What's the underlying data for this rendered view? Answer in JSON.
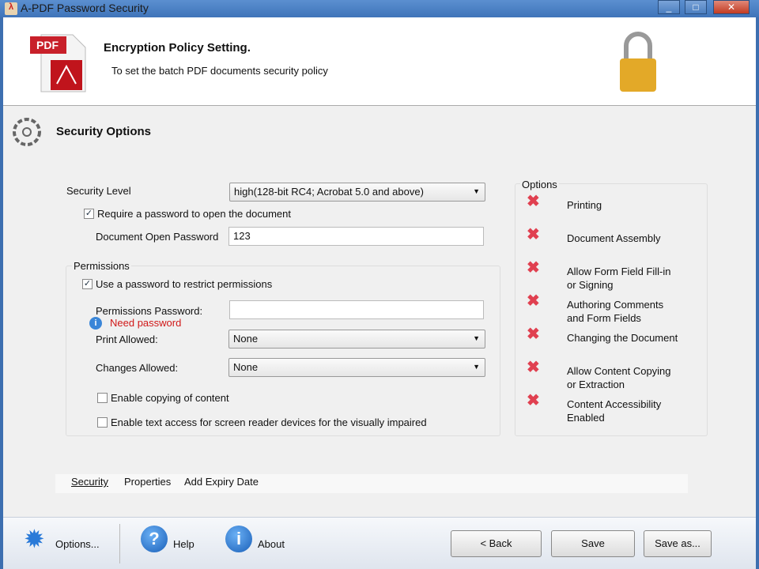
{
  "window": {
    "title": "A-PDF Password Security"
  },
  "header": {
    "title": "Encryption Policy Setting.",
    "subtitle": "To set the batch PDF documents security policy",
    "pdf_label": "PDF"
  },
  "section": {
    "title": "Security Options"
  },
  "form": {
    "security_level_label": "Security Level",
    "security_level_value": "high(128-bit RC4; Acrobat 5.0 and above)",
    "require_open_pw_label": "Require a password to open the document",
    "require_open_pw_checked": true,
    "open_pw_label": "Document Open Password",
    "open_pw_value": "123",
    "permissions_group": "Permissions",
    "use_perm_pw_label": "Use a password to restrict permissions",
    "use_perm_pw_checked": true,
    "perm_pw_label": "Permissions Password:",
    "perm_pw_value": "",
    "perm_pw_error": "Need password",
    "print_label": "Print Allowed:",
    "print_value": "None",
    "changes_label": "Changes Allowed:",
    "changes_value": "None",
    "enable_copy_label": "Enable copying of content",
    "enable_reader_label": "Enable text access for screen reader devices for the visually impaired"
  },
  "options": {
    "title": "Options",
    "items": [
      {
        "l1": "Printing",
        "l2": ""
      },
      {
        "l1": "Document Assembly",
        "l2": ""
      },
      {
        "l1": "Allow Form Field Fill-in",
        "l2": "or Signing"
      },
      {
        "l1": "Authoring Comments",
        "l2": "and Form Fields"
      },
      {
        "l1": "Changing the Document",
        "l2": ""
      },
      {
        "l1": "Allow Content Copying",
        "l2": "or Extraction"
      },
      {
        "l1": "Content Accessibility",
        "l2": "Enabled"
      }
    ]
  },
  "tabs": [
    "Security",
    "Properties",
    "Add Expiry Date"
  ],
  "toolbar": {
    "options": "Options...",
    "help": "Help",
    "about": "About",
    "back": "< Back",
    "save": "Save",
    "save_as": "Save as..."
  }
}
